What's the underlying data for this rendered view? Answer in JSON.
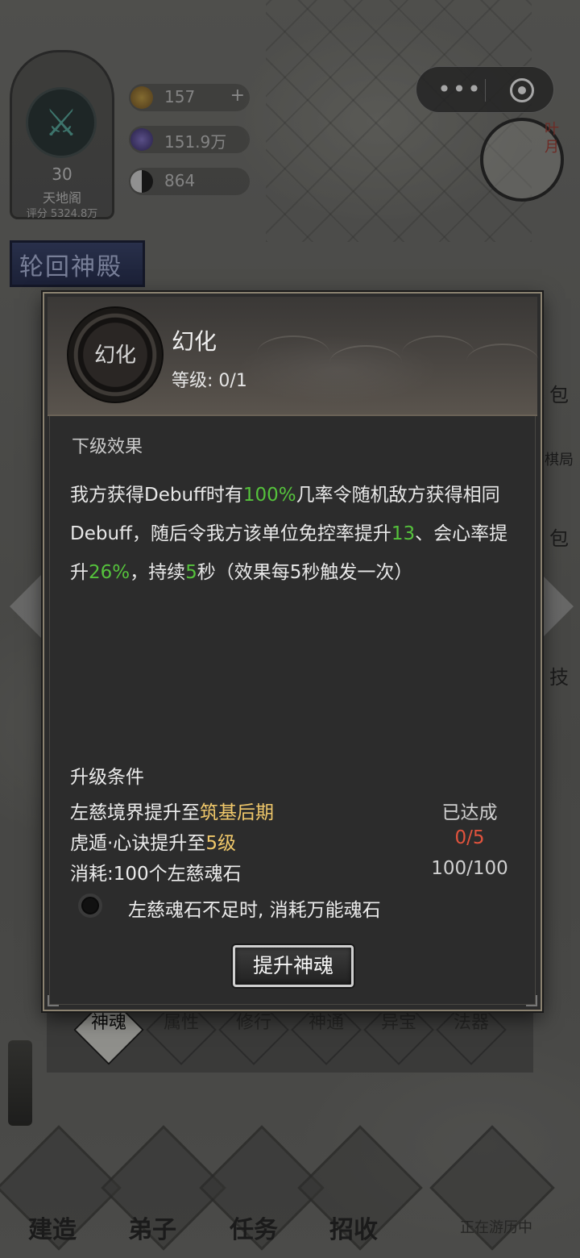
{
  "hud": {
    "badge": {
      "level": "30",
      "name": "天地阁",
      "score": "评分 5324.8万"
    },
    "resources": [
      {
        "value": "157",
        "plus": "+"
      },
      {
        "value": "151.9万"
      },
      {
        "value": "864"
      }
    ],
    "clock_label": "叶月",
    "palace_title": "轮回神殿",
    "capsule": {
      "more": "•••"
    }
  },
  "side_labels": [
    "包",
    "棋局",
    "包",
    "技"
  ],
  "tabs": [
    "神魂",
    "属性",
    "修行",
    "神通",
    "异宝",
    "法器"
  ],
  "bottom_nav": [
    "建造",
    "弟子",
    "任务",
    "招收"
  ],
  "travel_status": "正在游历中",
  "modal": {
    "icon_label": "幻化",
    "skill_name": "幻化",
    "level_text": "等级: 0/1",
    "next_effect_title": "下级效果",
    "effect": {
      "p1": "我方获得Debuff时有",
      "v1": "100%",
      "p2": "几率令随机敌方获得相同Debuff，随后令我方该单位免控率提升",
      "v2": "13",
      "p3": "、会心率提升",
      "v3": "26%",
      "p4": "，持续",
      "v4": "5",
      "p5": "秒（效果每5秒触发一次）"
    },
    "conditions_title": "升级条件",
    "conditions": [
      {
        "prefix": "左慈境界提升至",
        "highlight": "筑基后期",
        "status": "已达成"
      },
      {
        "prefix": "虎遁·心诀提升至",
        "highlight": "5级",
        "status": "0/5"
      },
      {
        "prefix": "消耗:100个左慈魂石",
        "highlight": "",
        "status": "100/100"
      }
    ],
    "substitute_option": "左慈魂石不足时, 消耗万能魂石",
    "upgrade_button": "提升神魂"
  }
}
